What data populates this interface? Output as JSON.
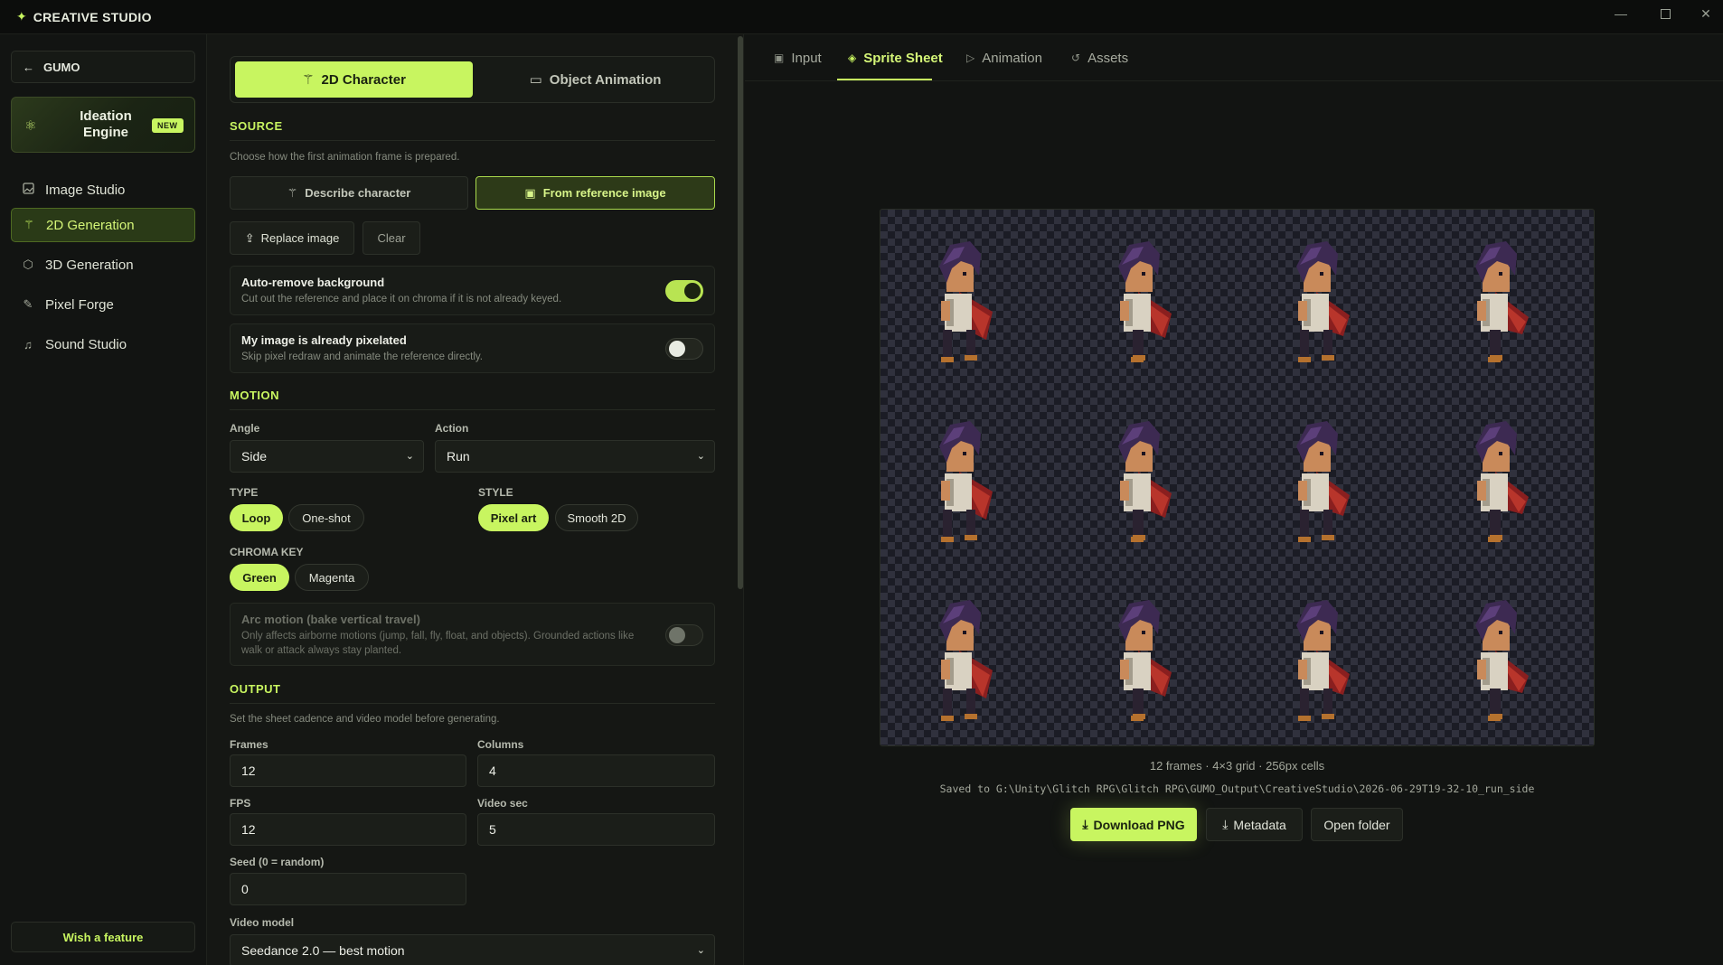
{
  "app": {
    "title": "CREATIVE STUDIO"
  },
  "sidebar": {
    "back_label": "GUMO",
    "ideation": {
      "label": "Ideation Engine",
      "badge": "NEW"
    },
    "items": [
      {
        "label": "Image Studio",
        "icon": "image-icon"
      },
      {
        "label": "2D Generation",
        "icon": "wand-icon",
        "active": true
      },
      {
        "label": "3D Generation",
        "icon": "cube-icon"
      },
      {
        "label": "Pixel Forge",
        "icon": "brush-icon"
      },
      {
        "label": "Sound Studio",
        "icon": "music-icon"
      }
    ],
    "wish_label": "Wish a feature"
  },
  "form": {
    "mode_tabs": [
      "2D Character",
      "Object Animation"
    ],
    "source": {
      "title": "SOURCE",
      "help": "Choose how the first animation frame is prepared.",
      "describe_label": "Describe character",
      "reference_label": "From reference image",
      "replace_label": "Replace image",
      "clear_label": "Clear"
    },
    "auto_remove": {
      "title": "Auto-remove background",
      "desc": "Cut out the reference and place it on chroma if it is not already keyed.",
      "on": true
    },
    "pixelated": {
      "title": "My image is already pixelated",
      "desc": "Skip pixel redraw and animate the reference directly.",
      "on": false
    },
    "motion": {
      "title": "MOTION",
      "angle_label": "Angle",
      "angle_value": "Side",
      "action_label": "Action",
      "action_value": "Run",
      "type_label": "TYPE",
      "type_options": [
        "Loop",
        "One-shot"
      ],
      "style_label": "STYLE",
      "style_options": [
        "Pixel art",
        "Smooth 2D"
      ],
      "chroma_label": "CHROMA KEY",
      "chroma_options": [
        "Green",
        "Magenta"
      ]
    },
    "arc": {
      "title": "Arc motion (bake vertical travel)",
      "desc": "Only affects airborne motions (jump, fall, fly, float, and objects). Grounded actions like walk or attack always stay planted.",
      "on": false
    },
    "output": {
      "title": "OUTPUT",
      "help": "Set the sheet cadence and video model before generating.",
      "frames_label": "Frames",
      "frames_value": "12",
      "columns_label": "Columns",
      "columns_value": "4",
      "fps_label": "FPS",
      "fps_value": "12",
      "video_sec_label": "Video sec",
      "video_sec_value": "5",
      "seed_label": "Seed (0 = random)",
      "seed_value": "0",
      "video_model_label": "Video model",
      "video_model_value": "Seedance 2.0 — best motion"
    }
  },
  "main": {
    "tabs": [
      {
        "label": "Input",
        "icon": "image-icon"
      },
      {
        "label": "Sprite Sheet",
        "icon": "layers-icon",
        "active": true
      },
      {
        "label": "Animation",
        "icon": "play-icon"
      },
      {
        "label": "Assets",
        "icon": "history-icon"
      }
    ],
    "sheet_info": "12 frames · 4×3 grid · 256px cells",
    "saved_path": "Saved to G:\\Unity\\Glitch RPG\\Glitch RPG\\GUMO_Output\\CreativeStudio\\2026-06-29T19-32-10_run_side",
    "actions": {
      "download": "Download PNG",
      "metadata": "Metadata",
      "open_folder": "Open folder"
    }
  },
  "colors": {
    "accent": "#c8f560",
    "bg": "#121412",
    "panel": "#151714"
  }
}
